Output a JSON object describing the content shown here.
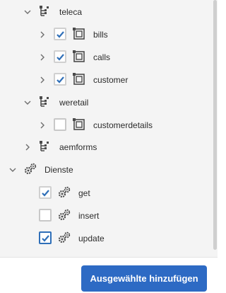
{
  "tree": {
    "nodes": [
      {
        "name": "teleca",
        "icon": "schema-icon",
        "expanded": true
      },
      {
        "name": "bills",
        "icon": "table-icon",
        "checked": true
      },
      {
        "name": "calls",
        "icon": "table-icon",
        "checked": true
      },
      {
        "name": "customer",
        "icon": "table-icon",
        "checked": true
      },
      {
        "name": "weretail",
        "icon": "schema-icon",
        "expanded": true
      },
      {
        "name": "customerdetails",
        "icon": "table-icon",
        "checked": false
      },
      {
        "name": "aemforms",
        "icon": "schema-icon",
        "expanded": false
      },
      {
        "name": "Dienste",
        "icon": "services-icon",
        "expanded": true
      },
      {
        "name": "get",
        "icon": "gears-icon",
        "checked": true
      },
      {
        "name": "insert",
        "icon": "gears-icon",
        "checked": false
      },
      {
        "name": "update",
        "icon": "gears-icon",
        "checked": true
      }
    ]
  },
  "footer": {
    "add_button_label": "Ausgewählte hinzufügen"
  },
  "colors": {
    "accent": "#2d6ac4",
    "check": "#2f6fb8",
    "panel_bg": "#f4f4f4"
  }
}
